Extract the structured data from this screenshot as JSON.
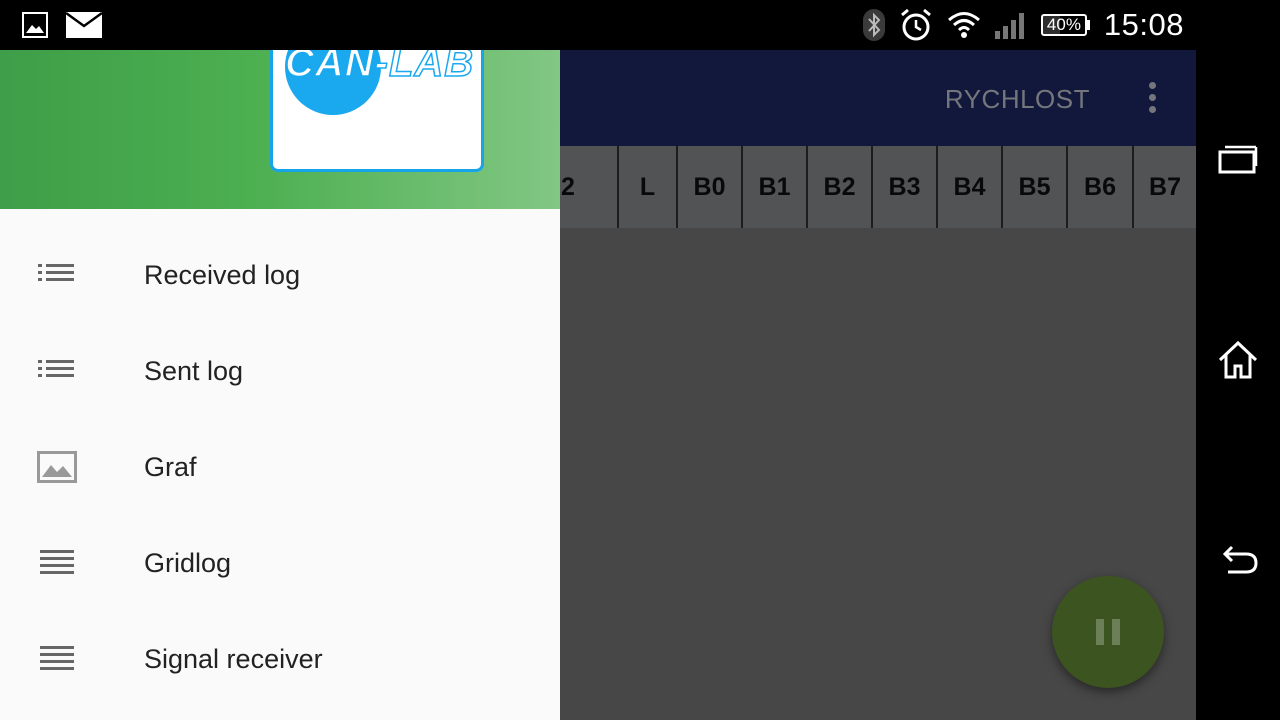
{
  "status_bar": {
    "left_icons": [
      "image-icon",
      "mail-icon"
    ],
    "right_icons": [
      "bluetooth-icon",
      "alarm-icon",
      "wifi-icon",
      "signal-icon"
    ],
    "battery": "40%",
    "battery_level": 0.4,
    "time": "15:08"
  },
  "toolbar": {
    "action_label": "RYCHLOST",
    "overflow_icon": "more-vertical-icon",
    "background": "#1e2a66"
  },
  "table_header": {
    "columns": [
      "2",
      "L",
      "B0",
      "B1",
      "B2",
      "B3",
      "B4",
      "B5",
      "B6",
      "B7"
    ]
  },
  "drawer": {
    "header_logo": "CAN-LAB",
    "header_color": "#4caf50",
    "items": [
      {
        "label": "Received log",
        "icon": "list-icon"
      },
      {
        "label": "Sent log",
        "icon": "list-icon"
      },
      {
        "label": "Graf",
        "icon": "image-icon"
      },
      {
        "label": "Gridlog",
        "icon": "lines-icon"
      },
      {
        "label": "Signal receiver",
        "icon": "lines-icon"
      }
    ]
  },
  "fab": {
    "icon": "pause-icon",
    "color": "#3c5420"
  },
  "nav_bar": {
    "buttons": [
      "recent-apps-icon",
      "home-icon",
      "back-icon"
    ]
  }
}
